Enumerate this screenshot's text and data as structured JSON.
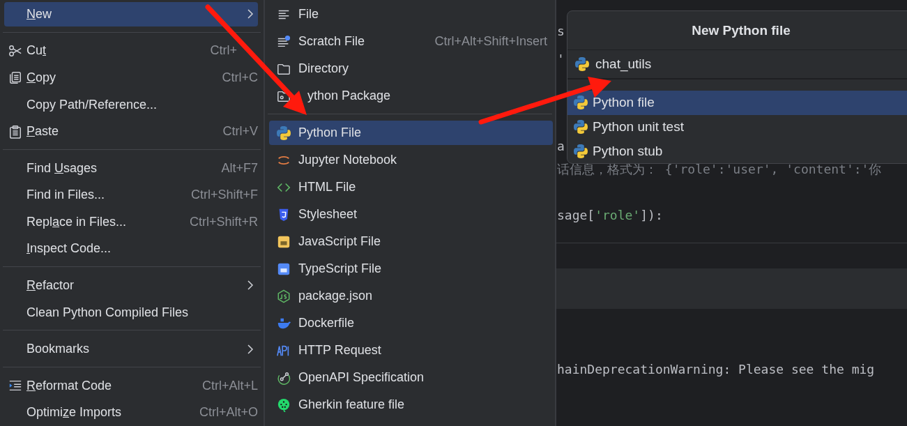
{
  "context_menu": {
    "groups": [
      [
        {
          "label": "New",
          "submenu": true,
          "selected": true
        }
      ],
      [
        {
          "label": "Cut",
          "shortcut": "Ctrl+",
          "selected": false
        },
        {
          "label": "Copy",
          "shortcut": "Ctrl+C",
          "selected": false
        },
        {
          "label": "Copy Path/Reference...",
          "selected": false
        },
        {
          "label": "Paste",
          "shortcut": "Ctrl+V",
          "selected": false
        }
      ],
      [
        {
          "label": "Find Usages",
          "shortcut": "Alt+F7",
          "selected": false
        },
        {
          "label": "Find in Files...",
          "shortcut": "Ctrl+Shift+F",
          "selected": false
        },
        {
          "label": "Replace in Files...",
          "shortcut": "Ctrl+Shift+R",
          "selected": false
        },
        {
          "label": "Inspect Code...",
          "selected": false
        }
      ],
      [
        {
          "label": "Refactor",
          "submenu": true,
          "selected": false
        },
        {
          "label": "Clean Python Compiled Files",
          "selected": false
        }
      ],
      [
        {
          "label": "Bookmarks",
          "submenu": true,
          "selected": false
        }
      ],
      [
        {
          "label": "Reformat Code",
          "shortcut": "Ctrl+Alt+L",
          "selected": false
        },
        {
          "label": "Optimize Imports",
          "shortcut": "Ctrl+Alt+O",
          "selected": false
        }
      ]
    ]
  },
  "new_submenu": {
    "groups": [
      [
        {
          "label": "File",
          "selected": false
        },
        {
          "label": "Scratch File",
          "shortcut": "Ctrl+Alt+Shift+Insert",
          "selected": false
        },
        {
          "label": "Directory",
          "selected": false
        },
        {
          "label": "ython Package",
          "selected": false
        }
      ],
      [
        {
          "label": "Python File",
          "selected": true
        },
        {
          "label": "Jupyter Notebook",
          "selected": false
        },
        {
          "label": "HTML File",
          "selected": false
        },
        {
          "label": "Stylesheet",
          "selected": false
        },
        {
          "label": "JavaScript File",
          "selected": false
        },
        {
          "label": "TypeScript File",
          "selected": false
        },
        {
          "label": "package.json",
          "selected": false
        },
        {
          "label": "Dockerfile",
          "selected": false
        },
        {
          "label": "HTTP Request",
          "selected": false
        },
        {
          "label": "OpenAPI Specification",
          "selected": false
        },
        {
          "label": "Gherkin feature file",
          "selected": false
        }
      ]
    ]
  },
  "editor": {
    "lines": [
      [
        {
          "text": "s",
          "kind": "plain"
        }
      ],
      [
        {
          "text": "'",
          "kind": "plain"
        }
      ],
      [
        {
          "text": "a",
          "kind": "plain"
        }
      ],
      [
        {
          "text": "话信息，格式为： {'role':'user', 'content':'你",
          "kind": "comment"
        }
      ],
      [
        {
          "text": "sage[",
          "kind": "plain"
        },
        {
          "text": "'role'",
          "kind": "string"
        },
        {
          "text": "]):",
          "kind": "plain"
        }
      ],
      [
        {
          "text": "hainDeprecationWarning: Please see the mig",
          "kind": "plain"
        }
      ]
    ]
  },
  "dialog": {
    "title": "New Python file",
    "name_field": {
      "value": "chat_utils"
    },
    "options": [
      {
        "label": "Python file",
        "selected": true
      },
      {
        "label": "Python unit test",
        "selected": false
      },
      {
        "label": "Python stub",
        "selected": false
      }
    ]
  }
}
